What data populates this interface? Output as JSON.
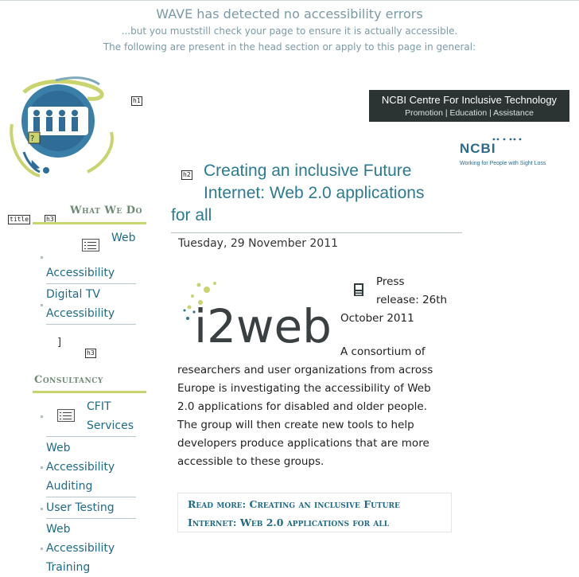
{
  "wave": {
    "headline": "WAVE has detected no accessibility errors",
    "line2": "...but you muststill check your page to ensure it is actually accessible.",
    "line3": "The following are present in the head section or apply to this page in general:",
    "tags": {
      "h1": "h1",
      "h2": "h2",
      "h3a": "h3",
      "h3b": "h3",
      "title": "title",
      "bracket": "]"
    }
  },
  "site": {
    "ncbi_centre": {
      "title": "NCBI Centre  For Inclusive Technology",
      "subtitle": "Promotion | Education | Assistance"
    },
    "ncbi_logo": {
      "word": "NCBI",
      "tagline": "Working for People with Sight Loss"
    }
  },
  "sidebar": {
    "what_we_do": {
      "heading": "What We Do",
      "items": [
        {
          "lines": [
            "Web",
            "Accessibility"
          ]
        },
        {
          "lines": [
            "Digital TV",
            "Accessibility"
          ]
        }
      ]
    },
    "consultancy": {
      "heading": "Consultancy",
      "items": [
        {
          "lines": [
            "CFIT",
            "Services"
          ]
        },
        {
          "lines": [
            "Web",
            "Accessibility",
            "Auditing"
          ]
        },
        {
          "lines": [
            "User Testing"
          ]
        },
        {
          "lines": [
            "Web",
            "Accessibility",
            "Training"
          ]
        }
      ]
    }
  },
  "article": {
    "title_lines": [
      "Creating an inclusive Future",
      "Internet: Web 2.0 applications",
      "for all"
    ],
    "date": "Tuesday, 29 November 2011",
    "image_text": "i2web",
    "press_lines": [
      "Press",
      "release: 26th",
      "October 2011"
    ],
    "body_lines": [
      "A consortium of",
      "researchers and user organizations from across",
      "Europe is investigating the accessibility of Web",
      "2.0 applications for disabled and older people.",
      "The group will then create new tools to help",
      "developers produce applications that are more",
      "accessible to these groups."
    ],
    "read_more_lines": [
      "Read more: Creating an inclusive Future",
      "Internet: Web 2.0 applications for all"
    ]
  },
  "colors": {
    "link": "#1f6a85",
    "title": "#2b7a8f",
    "rule": "#c9d46e",
    "heading": "#6f8a74"
  }
}
